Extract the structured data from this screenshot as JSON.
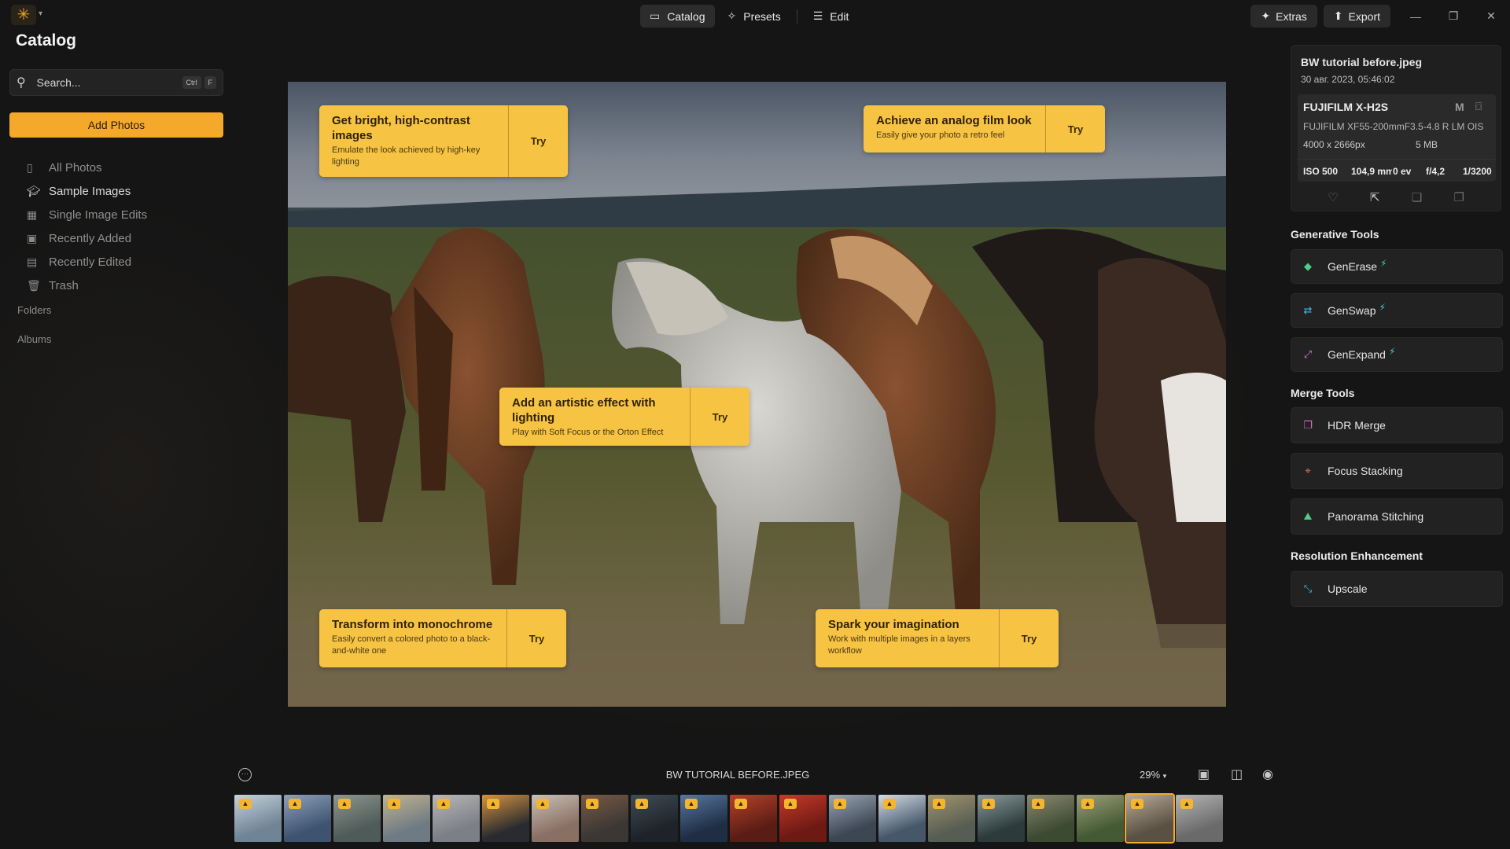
{
  "app": {
    "logo_icon": "sun-logo-icon",
    "accent": "#f4a92b"
  },
  "nav": {
    "tabs": [
      {
        "label": "Catalog",
        "icon": "folder-icon",
        "active": true
      },
      {
        "label": "Presets",
        "icon": "sparkle-icon",
        "active": false
      },
      {
        "label": "Edit",
        "icon": "sliders-icon",
        "active": false
      }
    ]
  },
  "topright": {
    "extras_label": "Extras",
    "export_label": "Export"
  },
  "sidebar": {
    "title": "Catalog",
    "search_placeholder": "Search...",
    "search_shortcut_1": "Ctrl",
    "search_shortcut_2": "F",
    "add_photos_label": "Add Photos",
    "items": [
      {
        "label": "All Photos",
        "icon": "photos-icon",
        "active": false
      },
      {
        "label": "Sample Images",
        "icon": "graduation-cap-icon",
        "active": true
      },
      {
        "label": "Single Image Edits",
        "icon": "grid-icon",
        "active": false
      },
      {
        "label": "Recently Added",
        "icon": "recently-added-icon",
        "active": false
      },
      {
        "label": "Recently Edited",
        "icon": "recently-edited-icon",
        "active": false
      },
      {
        "label": "Trash",
        "icon": "trash-icon",
        "active": false
      }
    ],
    "folders_label": "Folders",
    "albums_label": "Albums"
  },
  "cards": [
    {
      "title": "Get bright, high-contrast images",
      "desc": "Emulate the look achieved by high-key lighting",
      "try": "Try"
    },
    {
      "title": "Achieve an analog film look",
      "desc": "Easily give your photo a retro feel",
      "try": "Try"
    },
    {
      "title": "Add an artistic effect with lighting",
      "desc": "Play with Soft Focus or the Orton Effect",
      "try": "Try"
    },
    {
      "title": "Transform into monochrome",
      "desc": "Easily convert a colored photo to a black-and-white one",
      "try": "Try"
    },
    {
      "title": "Spark your imagination",
      "desc": "Work with multiple images in a layers workflow",
      "try": "Try"
    }
  ],
  "info": {
    "filename": "BW tutorial before.jpeg",
    "date": "30 авг. 2023, 05:46:02",
    "camera": "FUJIFILM X-H2S",
    "mode": "M",
    "lens": "FUJIFILM XF55-200mmF3.5-4.8 R LM OIS",
    "dimensions": "4000 x 2666px",
    "filesize": "5 MB",
    "iso": "ISO 500",
    "focal": "104,9 mm",
    "ev": "0 ev",
    "aperture": "f/4,2",
    "shutter": "1/3200"
  },
  "generative": {
    "heading": "Generative Tools",
    "tools": [
      {
        "label": "GenErase",
        "icon": "eraser-icon"
      },
      {
        "label": "GenSwap",
        "icon": "swap-icon"
      },
      {
        "label": "GenExpand",
        "icon": "expand-icon"
      }
    ]
  },
  "merge": {
    "heading": "Merge Tools",
    "tools": [
      {
        "label": "HDR Merge",
        "icon": "hdr-icon"
      },
      {
        "label": "Focus Stacking",
        "icon": "focus-icon"
      },
      {
        "label": "Panorama Stitching",
        "icon": "panorama-icon"
      }
    ]
  },
  "resolution": {
    "heading": "Resolution Enhancement",
    "tools": [
      {
        "label": "Upscale",
        "icon": "upscale-icon"
      }
    ]
  },
  "bottom": {
    "filename": "BW TUTORIAL BEFORE.JPEG",
    "zoom": "29%"
  },
  "filmstrip": {
    "selected_index": 18,
    "thumbs": [
      {
        "colors": [
          "#6f8496",
          "#c7d2da"
        ]
      },
      {
        "colors": [
          "#3d5370",
          "#8fa1b8"
        ]
      },
      {
        "colors": [
          "#4f5b58",
          "#8d978f"
        ]
      },
      {
        "colors": [
          "#6e7a84",
          "#c2b48e"
        ]
      },
      {
        "colors": [
          "#7c7f86",
          "#b8b8b6"
        ]
      },
      {
        "colors": [
          "#2a2b30",
          "#d69340"
        ]
      },
      {
        "colors": [
          "#8a6f63",
          "#c8c0b8"
        ]
      },
      {
        "colors": [
          "#3a3735",
          "#7a5a44"
        ]
      },
      {
        "colors": [
          "#1e2329",
          "#3f4c58"
        ]
      },
      {
        "colors": [
          "#1f2e44",
          "#5878a0"
        ]
      },
      {
        "colors": [
          "#5a1d15",
          "#b8402a"
        ]
      },
      {
        "colors": [
          "#6d1a14",
          "#c8392a"
        ]
      },
      {
        "colors": [
          "#3d4754",
          "#9aa6b4"
        ]
      },
      {
        "colors": [
          "#46576a",
          "#d5dde4"
        ]
      },
      {
        "colors": [
          "#565d52",
          "#a29470"
        ]
      },
      {
        "colors": [
          "#2c3a3a",
          "#8a9a9a"
        ]
      },
      {
        "colors": [
          "#3d4a32",
          "#8a8a70"
        ]
      },
      {
        "colors": [
          "#445a34",
          "#9ca07a"
        ]
      },
      {
        "colors": [
          "#5a5044",
          "#b8ab98"
        ]
      },
      {
        "colors": [
          "#6a6a6a",
          "#b5b5b5"
        ]
      }
    ]
  }
}
